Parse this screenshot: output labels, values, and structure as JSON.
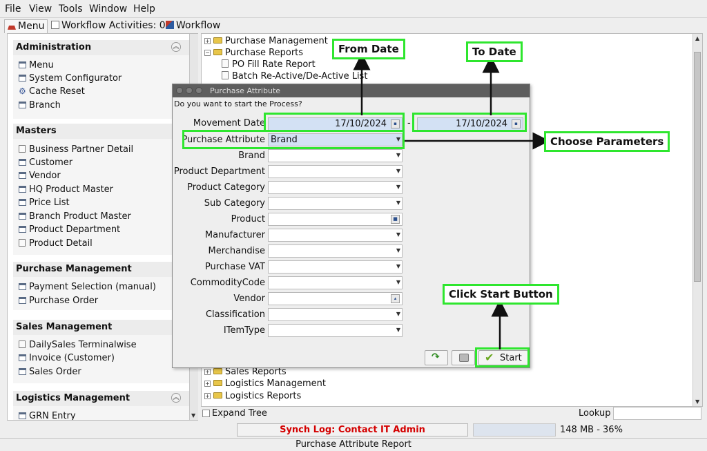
{
  "menubar": {
    "file": "File",
    "view": "View",
    "tools": "Tools",
    "window": "Window",
    "help": "Help"
  },
  "tabs": {
    "menu": "Menu",
    "workflow_activities": "Workflow Activities: 0",
    "workflow": "Workflow"
  },
  "left": {
    "administration": {
      "title": "Administration",
      "items": [
        "Menu",
        "System Configurator",
        "Cache Reset",
        "Branch"
      ]
    },
    "masters": {
      "title": "Masters",
      "items": [
        "Business Partner Detail",
        "Customer",
        "Vendor",
        "HQ Product Master",
        "Price List",
        "Branch Product Master",
        "Product Department",
        "Product Detail"
      ]
    },
    "purchase_management": {
      "title": "Purchase Management",
      "items": [
        "Payment Selection (manual)",
        "Purchase Order"
      ]
    },
    "sales_management": {
      "title": "Sales Management",
      "items": [
        "DailySales Terminalwise",
        "Invoice (Customer)",
        "Sales Order"
      ]
    },
    "logistics_management": {
      "title": "Logistics Management",
      "items": [
        "GRN Entry"
      ]
    }
  },
  "tree": {
    "purchase_management": "Purchase Management",
    "purchase_reports": "Purchase Reports",
    "po_fill_rate": "PO Fill Rate Report",
    "batch_reactive": "Batch Re-Active/De-Active List",
    "sales_reports": "Sales Reports",
    "logistics_management": "Logistics Management",
    "logistics_reports": "Logistics Reports"
  },
  "dialog": {
    "title": "Purchase Attribute",
    "question": "Do you want to start the Process?",
    "movement_date_label": "Movement Date",
    "from_date": "17/10/2024",
    "to_date": "17/10/2024",
    "date_separator": "-",
    "purchase_attribute_label": "Purchase Attribute",
    "purchase_attribute_value": "Brand",
    "fields": [
      "Brand",
      "Product Department",
      "Product Category",
      "Sub Category",
      "Product",
      "Manufacturer",
      "Merchandise",
      "Purchase VAT",
      "CommodityCode",
      "Vendor",
      "Classification",
      "ITemType"
    ],
    "start_label": "Start"
  },
  "annotations": {
    "from_date": "From Date",
    "to_date": "To Date",
    "choose_parameters": "Choose Parameters",
    "click_start": "Click Start Button"
  },
  "bottom": {
    "expand_tree": "Expand Tree",
    "lookup": "Lookup",
    "synch_log": "Synch Log: Contact IT Admin",
    "memory": "148 MB - 36%",
    "status": "Purchase Attribute Report"
  },
  "colors": {
    "highlight": "#2ee62e",
    "synch_text": "#d40000",
    "selection": "#d3e1f4",
    "title_bar": "#5e5e5e"
  }
}
